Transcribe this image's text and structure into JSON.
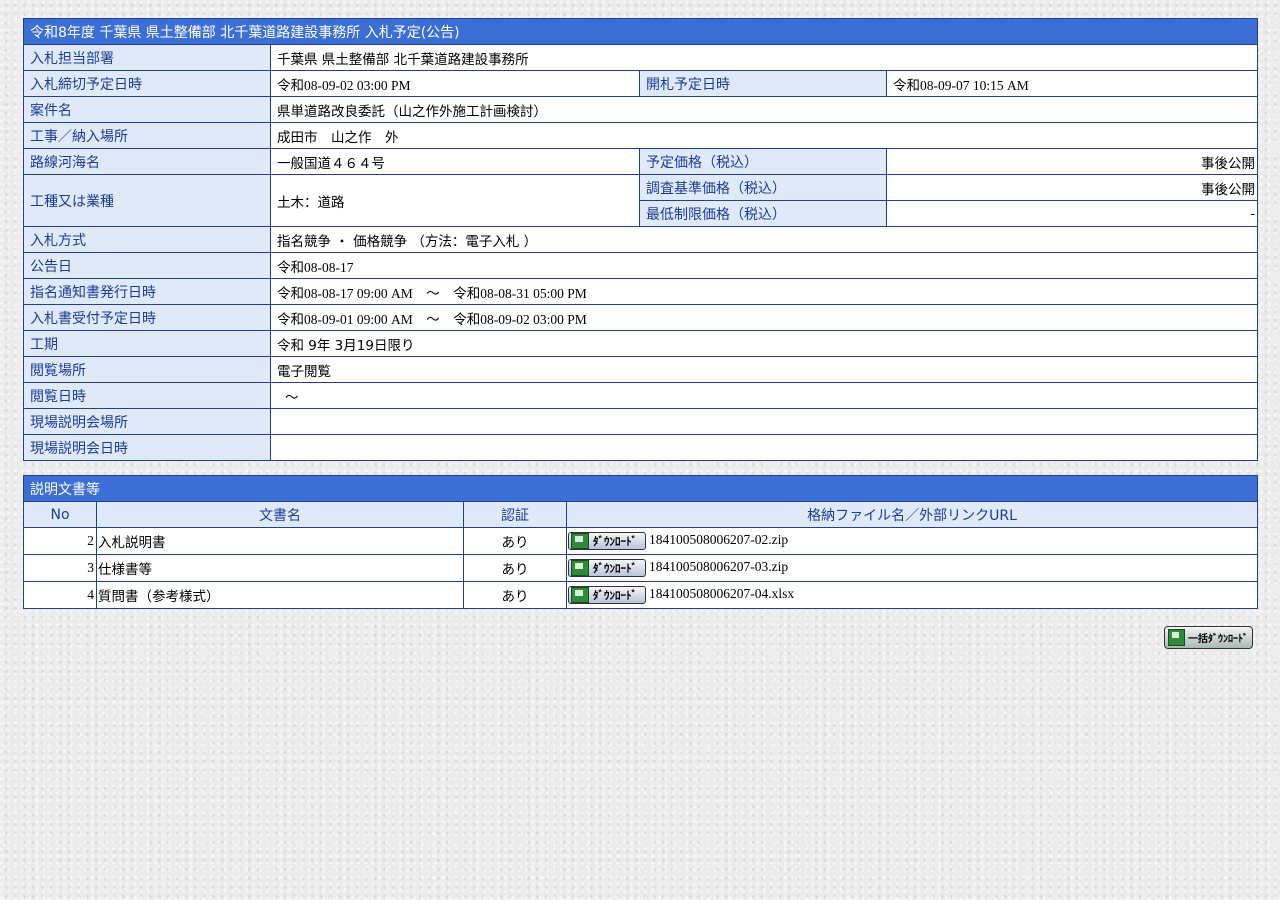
{
  "header": {
    "title": "令和8年度 千葉県 県土整備部 北千葉道路建設事務所 入札予定(公告)"
  },
  "info": {
    "dept_label": "入札担当部署",
    "dept": "千葉県 県土整備部 北千葉道路建設事務所",
    "deadline_label": "入札締切予定日時",
    "deadline": "令和08-09-02 03:00 PM",
    "open_label": "開札予定日時",
    "open": "令和08-09-07 10:15 AM",
    "case_label": "案件名",
    "case": "県単道路改良委託（山之作外施工計画検討）",
    "place_label": "工事／納入場所",
    "place": "成田市　山之作　外",
    "route_label": "路線河海名",
    "route": "一般国道４６４号",
    "price_label": "予定価格（税込）",
    "price": "事後公開",
    "type_label": "工種又は業種",
    "type": "土木：道路",
    "survey_label": "調査基準価格（税込）",
    "survey": "事後公開",
    "min_label": "最低制限価格（税込）",
    "min": "-",
    "method_label": "入札方式",
    "method": "指名競争 ・ 価格競争 （方法：電子入札 ）",
    "notice_label": "公告日",
    "notice": "令和08-08-17",
    "notify_label": "指名通知書発行日時",
    "notify": "令和08-08-17 09:00 AM　～　令和08-08-31 05:00 PM",
    "receive_label": "入札書受付予定日時",
    "receive": "令和08-09-01 09:00 AM　～　令和08-09-02 03:00 PM",
    "period_label": "工期",
    "period": "令和 9年 3月19日限り",
    "view_place_label": "閲覧場所",
    "view_place": "電子閲覧",
    "view_date_label": "閲覧日時",
    "view_date": "～",
    "site_place_label": "現場説明会場所",
    "site_place": "",
    "site_date_label": "現場説明会日時",
    "site_date": ""
  },
  "docs": {
    "title": "説明文書等",
    "columns": [
      "No",
      "文書名",
      "認証",
      "格納ファイル名／外部リンクURL"
    ],
    "rows": [
      {
        "no": "2",
        "name": "入札説明書",
        "auth": "あり",
        "file": "184100508006207-02.zip"
      },
      {
        "no": "3",
        "name": "仕様書等",
        "auth": "あり",
        "file": "184100508006207-03.zip"
      },
      {
        "no": "4",
        "name": "質問書（参考様式）",
        "auth": "あり",
        "file": "184100508006207-04.xlsx"
      }
    ],
    "download_label": "ﾀﾞｳﾝﾛｰﾄﾞ",
    "bulk_label": "一括ﾀﾞｳﾝﾛｰﾄﾞ"
  }
}
